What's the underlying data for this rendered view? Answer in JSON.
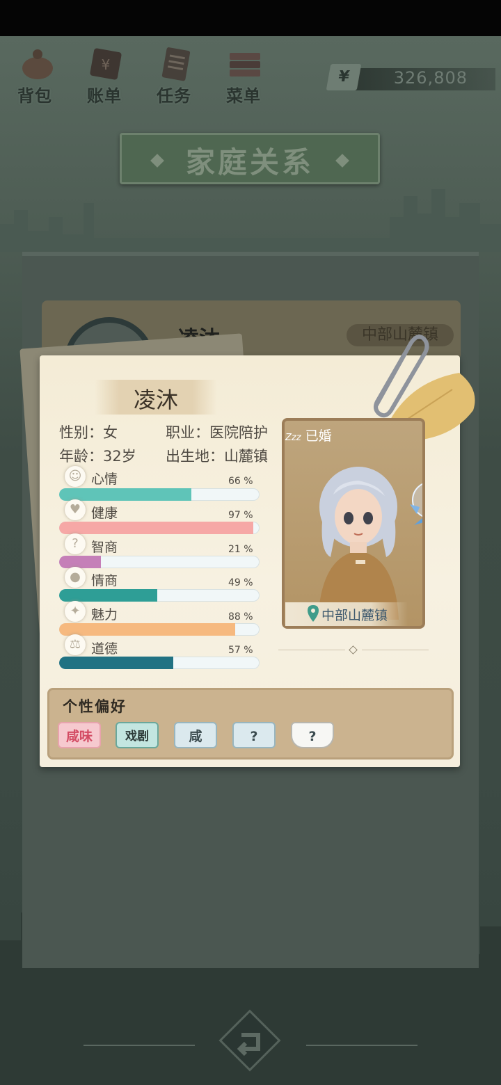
{
  "nav": {
    "items": [
      {
        "label": "背包",
        "icon": "bag-icon"
      },
      {
        "label": "账单",
        "icon": "bill-icon"
      },
      {
        "label": "任务",
        "icon": "task-icon"
      },
      {
        "label": "菜单",
        "icon": "menu-icon"
      }
    ],
    "currency_symbol": "¥",
    "currency_value": "326,808"
  },
  "title": "家庭关系",
  "back_card": {
    "name": "凌沐",
    "location": "中部山麓镇"
  },
  "character": {
    "name": "凌沐",
    "gender_label": "性别：女",
    "job_label": "职业：医院陪护",
    "age_label": "年龄：32岁",
    "birthplace_label": "出生地：山麓镇",
    "marital_status": "已婚",
    "sleep_icon_text": "Zzz",
    "location": "中部山麓镇"
  },
  "stats": [
    {
      "label": "心情",
      "percent_text": "66 %",
      "value": 0.66,
      "icon": "smile-icon",
      "color": "#5fc4b8"
    },
    {
      "label": "健康",
      "percent_text": "97 %",
      "value": 0.97,
      "icon": "heart-icon",
      "color": "#f6a8a6"
    },
    {
      "label": "智商",
      "percent_text": "21 %",
      "value": 0.21,
      "icon": "lightbulb-icon",
      "color": "#c57fb8"
    },
    {
      "label": "情商",
      "percent_text": "49 %",
      "value": 0.49,
      "icon": "apple-icon",
      "color": "#2e9e96"
    },
    {
      "label": "魅力",
      "percent_text": "88 %",
      "value": 0.88,
      "icon": "sparkle-icon",
      "color": "#f6b97f"
    },
    {
      "label": "道德",
      "percent_text": "57 %",
      "value": 0.57,
      "icon": "scales-icon",
      "color": "#217283"
    }
  ],
  "preferences": {
    "title": "个性偏好",
    "tags": [
      {
        "label": "咸味",
        "icon": "salty-tag"
      },
      {
        "label": "戏剧",
        "icon": "drama-book-icon"
      },
      {
        "label": "咸",
        "icon": "food-tray-icon"
      },
      {
        "label": "?",
        "icon": "food-tray-icon"
      },
      {
        "label": "?",
        "icon": "cup-icon"
      }
    ]
  },
  "colors": {
    "card_bg": "#f7f1e1",
    "accent_teal": "#5fc4b8",
    "panel_brown": "#cbb38f",
    "title_green": "#4f6751"
  }
}
